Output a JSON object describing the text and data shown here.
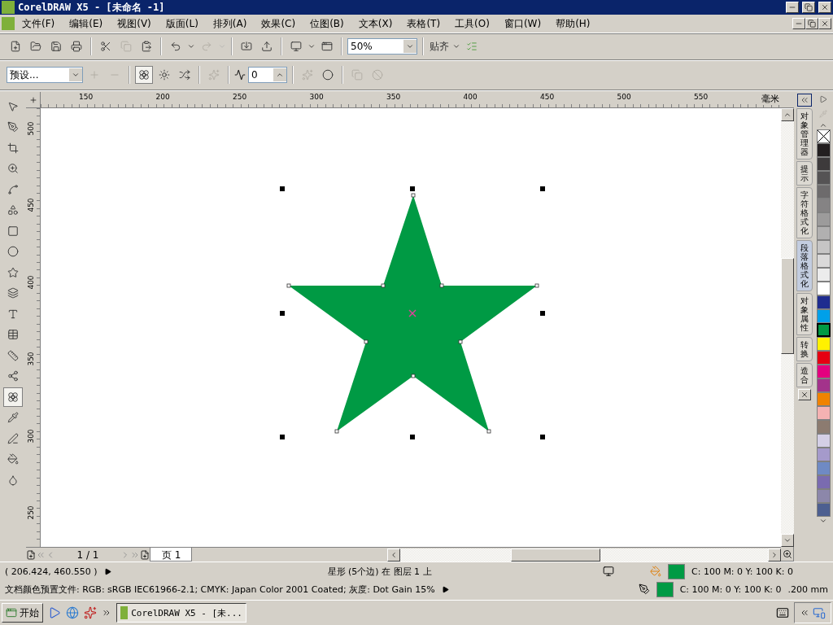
{
  "window": {
    "title": "CorelDRAW X5 - [未命名 -1]"
  },
  "menu": [
    {
      "label": "文件(F)"
    },
    {
      "label": "编辑(E)"
    },
    {
      "label": "视图(V)"
    },
    {
      "label": "版面(L)"
    },
    {
      "label": "排列(A)"
    },
    {
      "label": "效果(C)"
    },
    {
      "label": "位图(B)"
    },
    {
      "label": "文本(X)"
    },
    {
      "label": "表格(T)"
    },
    {
      "label": "工具(O)"
    },
    {
      "label": "窗口(W)"
    },
    {
      "label": "帮助(H)"
    }
  ],
  "standard_toolbar": {
    "zoom": "50%",
    "snap": "贴齐"
  },
  "property_bar": {
    "preset": "预设...",
    "sharpness": "0"
  },
  "tools": [
    {
      "kind": "pick",
      "selected": false
    },
    {
      "kind": "shape",
      "selected": false
    },
    {
      "kind": "crop",
      "selected": false
    },
    {
      "kind": "zoom",
      "selected": false
    },
    {
      "kind": "curve",
      "selected": false
    },
    {
      "kind": "smart",
      "selected": false
    },
    {
      "kind": "rectangle",
      "selected": false
    },
    {
      "kind": "ellipse",
      "selected": false
    },
    {
      "kind": "polygon",
      "selected": false
    },
    {
      "kind": "basic",
      "selected": false
    },
    {
      "kind": "text",
      "selected": false
    },
    {
      "kind": "table",
      "selected": false
    },
    {
      "kind": "dimension",
      "selected": false
    },
    {
      "kind": "connector",
      "selected": false
    },
    {
      "kind": "effect",
      "selected": true
    },
    {
      "kind": "eyedropper",
      "selected": false
    },
    {
      "kind": "outline",
      "selected": false
    },
    {
      "kind": "fill",
      "selected": false
    },
    {
      "kind": "interactive",
      "selected": false
    }
  ],
  "ruler": {
    "unit": "毫米",
    "x_labels": [
      "150",
      "200",
      "250",
      "300",
      "350",
      "400",
      "450",
      "500",
      "550"
    ],
    "y_labels": [
      "500",
      "450",
      "400",
      "350",
      "300",
      "250"
    ]
  },
  "shape": {
    "kind": "star"
  },
  "page_nav": {
    "pages": "1 / 1",
    "tab": "页 1"
  },
  "dockers": [
    {
      "label": "对象管理器",
      "selected": false
    },
    {
      "label": "提示",
      "selected": false
    },
    {
      "label": "字符格式化",
      "selected": false
    },
    {
      "label": "段落格式化",
      "selected": true
    },
    {
      "label": "对象属性",
      "selected": false
    },
    {
      "label": "转换",
      "selected": false
    },
    {
      "label": "造合",
      "selected": false
    }
  ],
  "palette": [
    {
      "kind": "none",
      "selected": false
    },
    {
      "kind": "color",
      "color": "#231f20",
      "selected": false
    },
    {
      "kind": "color",
      "color": "#3d3a3b",
      "selected": false
    },
    {
      "kind": "color",
      "color": "#555354",
      "selected": false
    },
    {
      "kind": "color",
      "color": "#6d6b6c",
      "selected": false
    },
    {
      "kind": "color",
      "color": "#858384",
      "selected": false
    },
    {
      "kind": "color",
      "color": "#9c9b9b",
      "selected": false
    },
    {
      "kind": "color",
      "color": "#b1b0b0",
      "selected": false
    },
    {
      "kind": "color",
      "color": "#c6c5c5",
      "selected": false
    },
    {
      "kind": "color",
      "color": "#dad9d9",
      "selected": false
    },
    {
      "kind": "color",
      "color": "#ececec",
      "selected": false
    },
    {
      "kind": "color",
      "color": "#ffffff",
      "selected": false
    },
    {
      "kind": "color",
      "color": "#1f2c8f",
      "selected": false
    },
    {
      "kind": "color",
      "color": "#00a0e9",
      "selected": false
    },
    {
      "kind": "color",
      "color": "#009a44",
      "selected": true
    },
    {
      "kind": "color",
      "color": "#fff100",
      "selected": false
    },
    {
      "kind": "color",
      "color": "#e60012",
      "selected": false
    },
    {
      "kind": "color",
      "color": "#e4007f",
      "selected": false
    },
    {
      "kind": "color",
      "color": "#a3338b",
      "selected": false
    },
    {
      "kind": "color",
      "color": "#f08300",
      "selected": false
    },
    {
      "kind": "color",
      "color": "#f5b2b2",
      "selected": false
    },
    {
      "kind": "color",
      "color": "#8c7b70",
      "selected": false
    },
    {
      "kind": "color",
      "color": "#d4cfe6",
      "selected": false
    },
    {
      "kind": "color",
      "color": "#a59acb",
      "selected": false
    },
    {
      "kind": "color",
      "color": "#6f8ac4",
      "selected": false
    },
    {
      "kind": "color",
      "color": "#7a6bb0",
      "selected": false
    },
    {
      "kind": "color",
      "color": "#8c87aa",
      "selected": false
    },
    {
      "kind": "color",
      "color": "#4d5f90",
      "selected": false
    }
  ],
  "status_bar": {
    "coordinates": "( 206.424, 460.550 )",
    "object_info": "星形 (5个边) 在 图层 1 上",
    "color_profile": "文档颜色预置文件: RGB: sRGB IEC61966-2.1; CMYK: Japan Color 2001 Coated; 灰度: Dot Gain 15%",
    "fill": {
      "color": "#009a44",
      "text": "C: 100 M: 0 Y: 100 K: 0"
    },
    "outline": {
      "color": "#009a44",
      "text": "C: 100 M: 0 Y: 100 K: 0",
      "width": ".200 mm"
    }
  },
  "taskbar": {
    "start": "开始",
    "task": "CorelDRAW X5 - [未..."
  }
}
